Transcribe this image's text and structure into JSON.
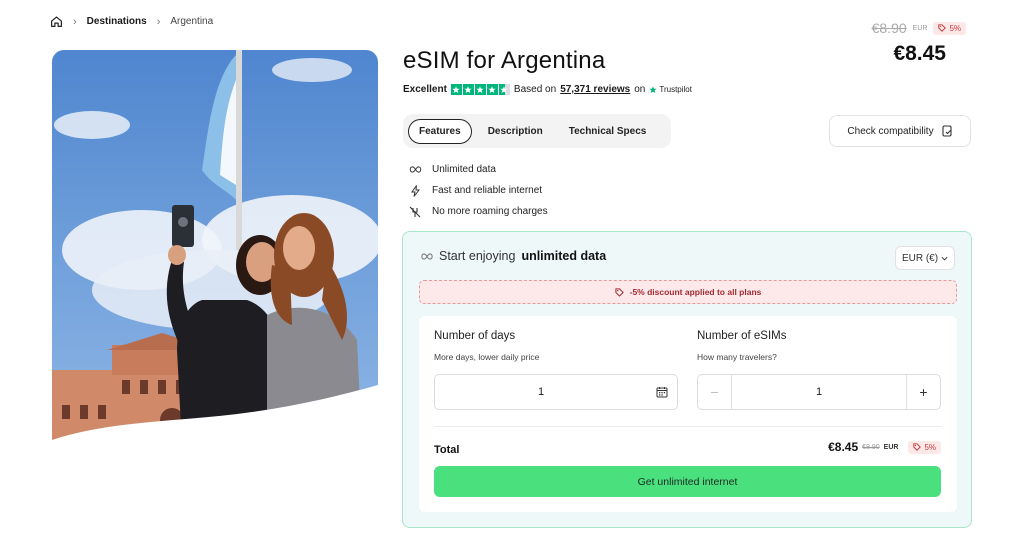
{
  "breadcrumb": {
    "home_icon": "home-icon",
    "items": [
      "Destinations",
      "Argentina"
    ]
  },
  "product": {
    "title": "eSIM for Argentina",
    "rating": {
      "label": "Excellent",
      "based_on": "Based on",
      "reviews": "57,371 reviews",
      "on": "on",
      "provider": "Trustpilot",
      "stars": 4.5
    }
  },
  "price": {
    "old": "€8.90",
    "old_currency": "EUR",
    "discount": "5%",
    "current": "€8.45"
  },
  "tabs": [
    "Features",
    "Description",
    "Technical Specs"
  ],
  "check_compatibility": "Check compatibility",
  "features": [
    {
      "icon": "infinity-icon",
      "text": "Unlimited data"
    },
    {
      "icon": "lightning-icon",
      "text": "Fast and reliable internet"
    },
    {
      "icon": "no-roaming-icon",
      "text": "No more roaming charges"
    }
  ],
  "plan": {
    "heading_prefix": "Start enjoying",
    "heading_bold": "unlimited data",
    "currency_select": "EUR (€)",
    "discount_notice": "-5% discount applied to all plans",
    "days": {
      "title": "Number of days",
      "subtitle": "More days, lower daily price",
      "value": "1"
    },
    "esims": {
      "title": "Number of eSIMs",
      "subtitle": "How many travelers?",
      "value": "1",
      "minus": "−",
      "plus": "+"
    },
    "total": {
      "label": "Total",
      "price": "€8.45",
      "old": "€8.90",
      "currency": "EUR",
      "discount": "5%"
    },
    "cta": "Get unlimited internet"
  },
  "colors": {
    "accent_green": "#4ae07e",
    "trustpilot_green": "#00b67a",
    "panel_bg": "#eef8f9",
    "discount_red": "#c43a3a"
  }
}
